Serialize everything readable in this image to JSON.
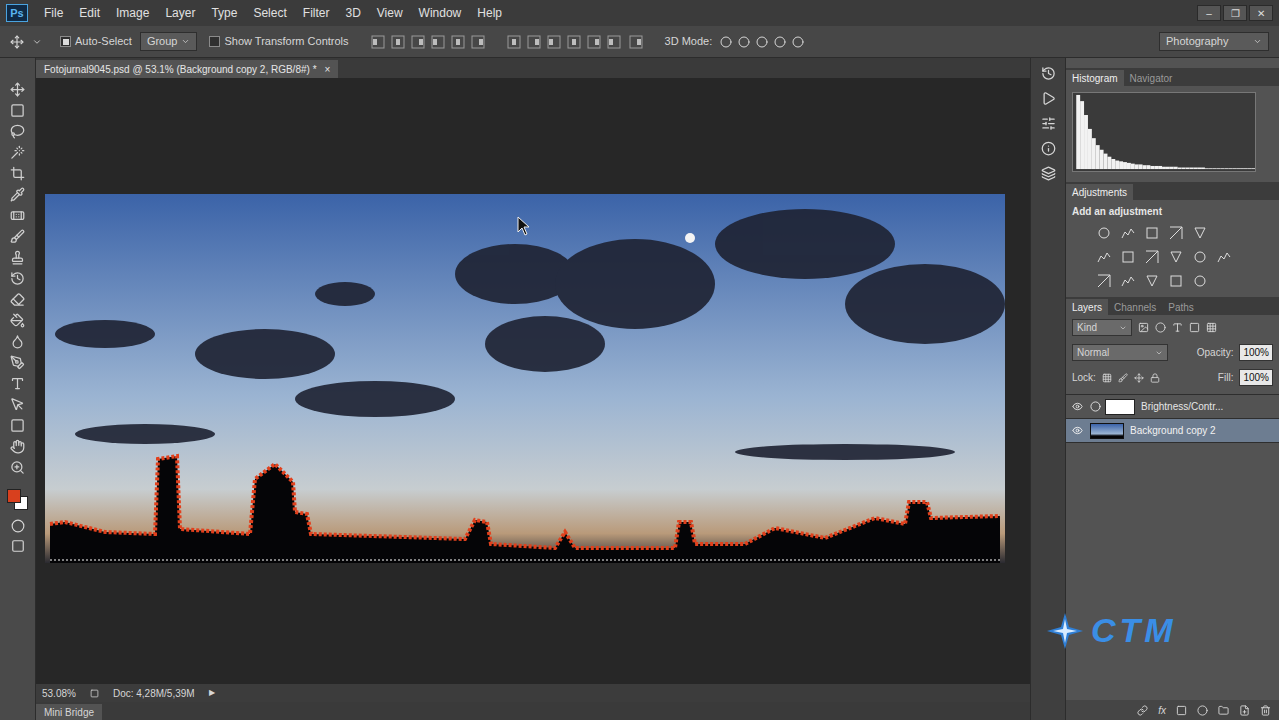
{
  "app": {
    "logo": "Ps"
  },
  "menu": [
    "File",
    "Edit",
    "Image",
    "Layer",
    "Type",
    "Select",
    "Filter",
    "3D",
    "View",
    "Window",
    "Help"
  ],
  "window_controls": [
    "–",
    "❐",
    "✕"
  ],
  "options_bar": {
    "auto_select": {
      "label": "Auto-Select",
      "checked": true
    },
    "target": "Group",
    "show_transform": {
      "label": "Show Transform Controls",
      "checked": false
    },
    "mode_label": "3D Mode:",
    "workspace": "Photography"
  },
  "swatches": {
    "foreground": "#d8401e",
    "background": "#ffffff"
  },
  "document": {
    "tab_title": "Fotojurnal9045.psd @ 53.1% (Background copy 2, RGB/8#) *",
    "close": "×",
    "zoom": "53.08%",
    "doc_info": "Doc: 4,28M/5,39M",
    "arrow": "▶"
  },
  "bottom_tab": "Mini Bridge",
  "histogram": {
    "tabs": [
      {
        "label": "Histogram",
        "selected": true
      },
      {
        "label": "Navigator",
        "selected": false
      }
    ],
    "values": [
      96,
      88,
      70,
      52,
      40,
      31,
      25,
      20,
      16,
      13,
      11,
      10,
      9,
      8,
      7,
      6,
      6,
      5,
      5,
      4,
      4,
      4,
      3,
      3,
      3,
      3,
      2,
      2,
      2,
      2,
      2,
      2,
      2,
      1,
      1,
      1,
      1,
      1,
      1,
      1,
      1,
      1,
      1,
      1,
      1,
      1
    ]
  },
  "adjustments": {
    "title": "Adjustments",
    "subtitle": "Add an adjustment"
  },
  "layers_panel": {
    "tabs": [
      {
        "label": "Layers",
        "selected": true
      },
      {
        "label": "Channels",
        "selected": false
      },
      {
        "label": "Paths",
        "selected": false
      }
    ],
    "filter": "Kind",
    "blend_mode": "Normal",
    "opacity_label": "Opacity:",
    "opacity": "100%",
    "lock_label": "Lock:",
    "fill_label": "Fill:",
    "fill": "100%",
    "layers": [
      {
        "name": "Brightness/Contr...",
        "kind": "adjustment",
        "visible": true,
        "selected": false
      },
      {
        "name": "Background copy 2",
        "kind": "image",
        "visible": true,
        "selected": true
      }
    ],
    "fx": "fx"
  },
  "watermark": {
    "text": "CTM"
  }
}
